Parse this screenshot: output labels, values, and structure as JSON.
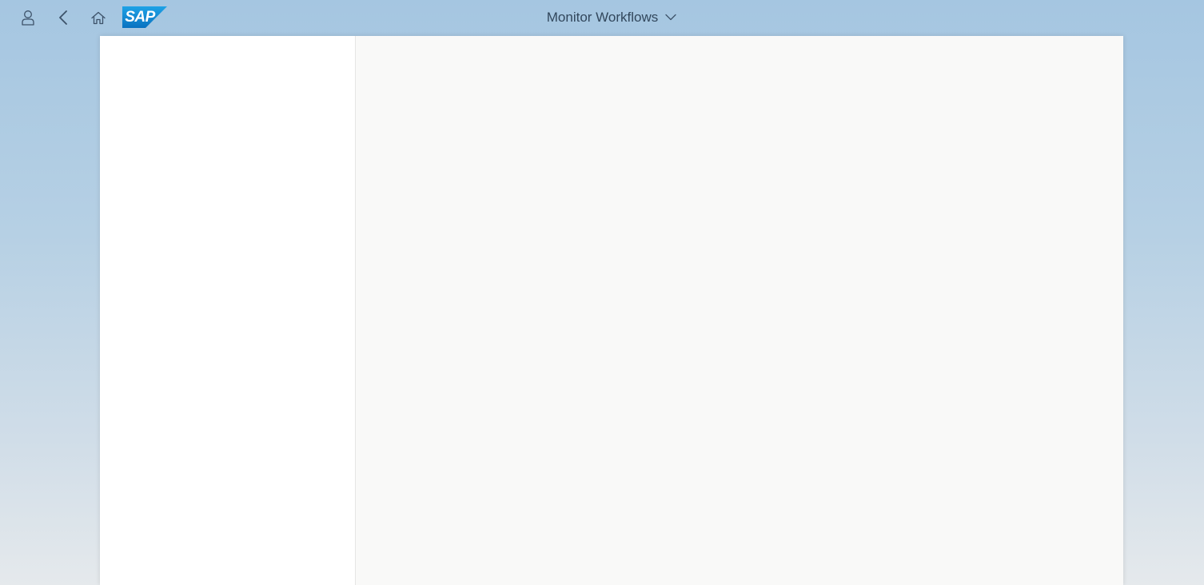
{
  "header": {
    "logo_text": "SAP",
    "app_title": "Monitor Workflows",
    "icons": {
      "user": "user-icon",
      "back": "back-icon",
      "home": "home-icon",
      "title_menu": "chevron-down-icon"
    }
  },
  "colors": {
    "header_icon": "#3d5269",
    "title_text": "#32475c",
    "logo_blue": "#1b8bd6",
    "master_background": "#ffffff",
    "detail_background": "#f9f9f8"
  }
}
